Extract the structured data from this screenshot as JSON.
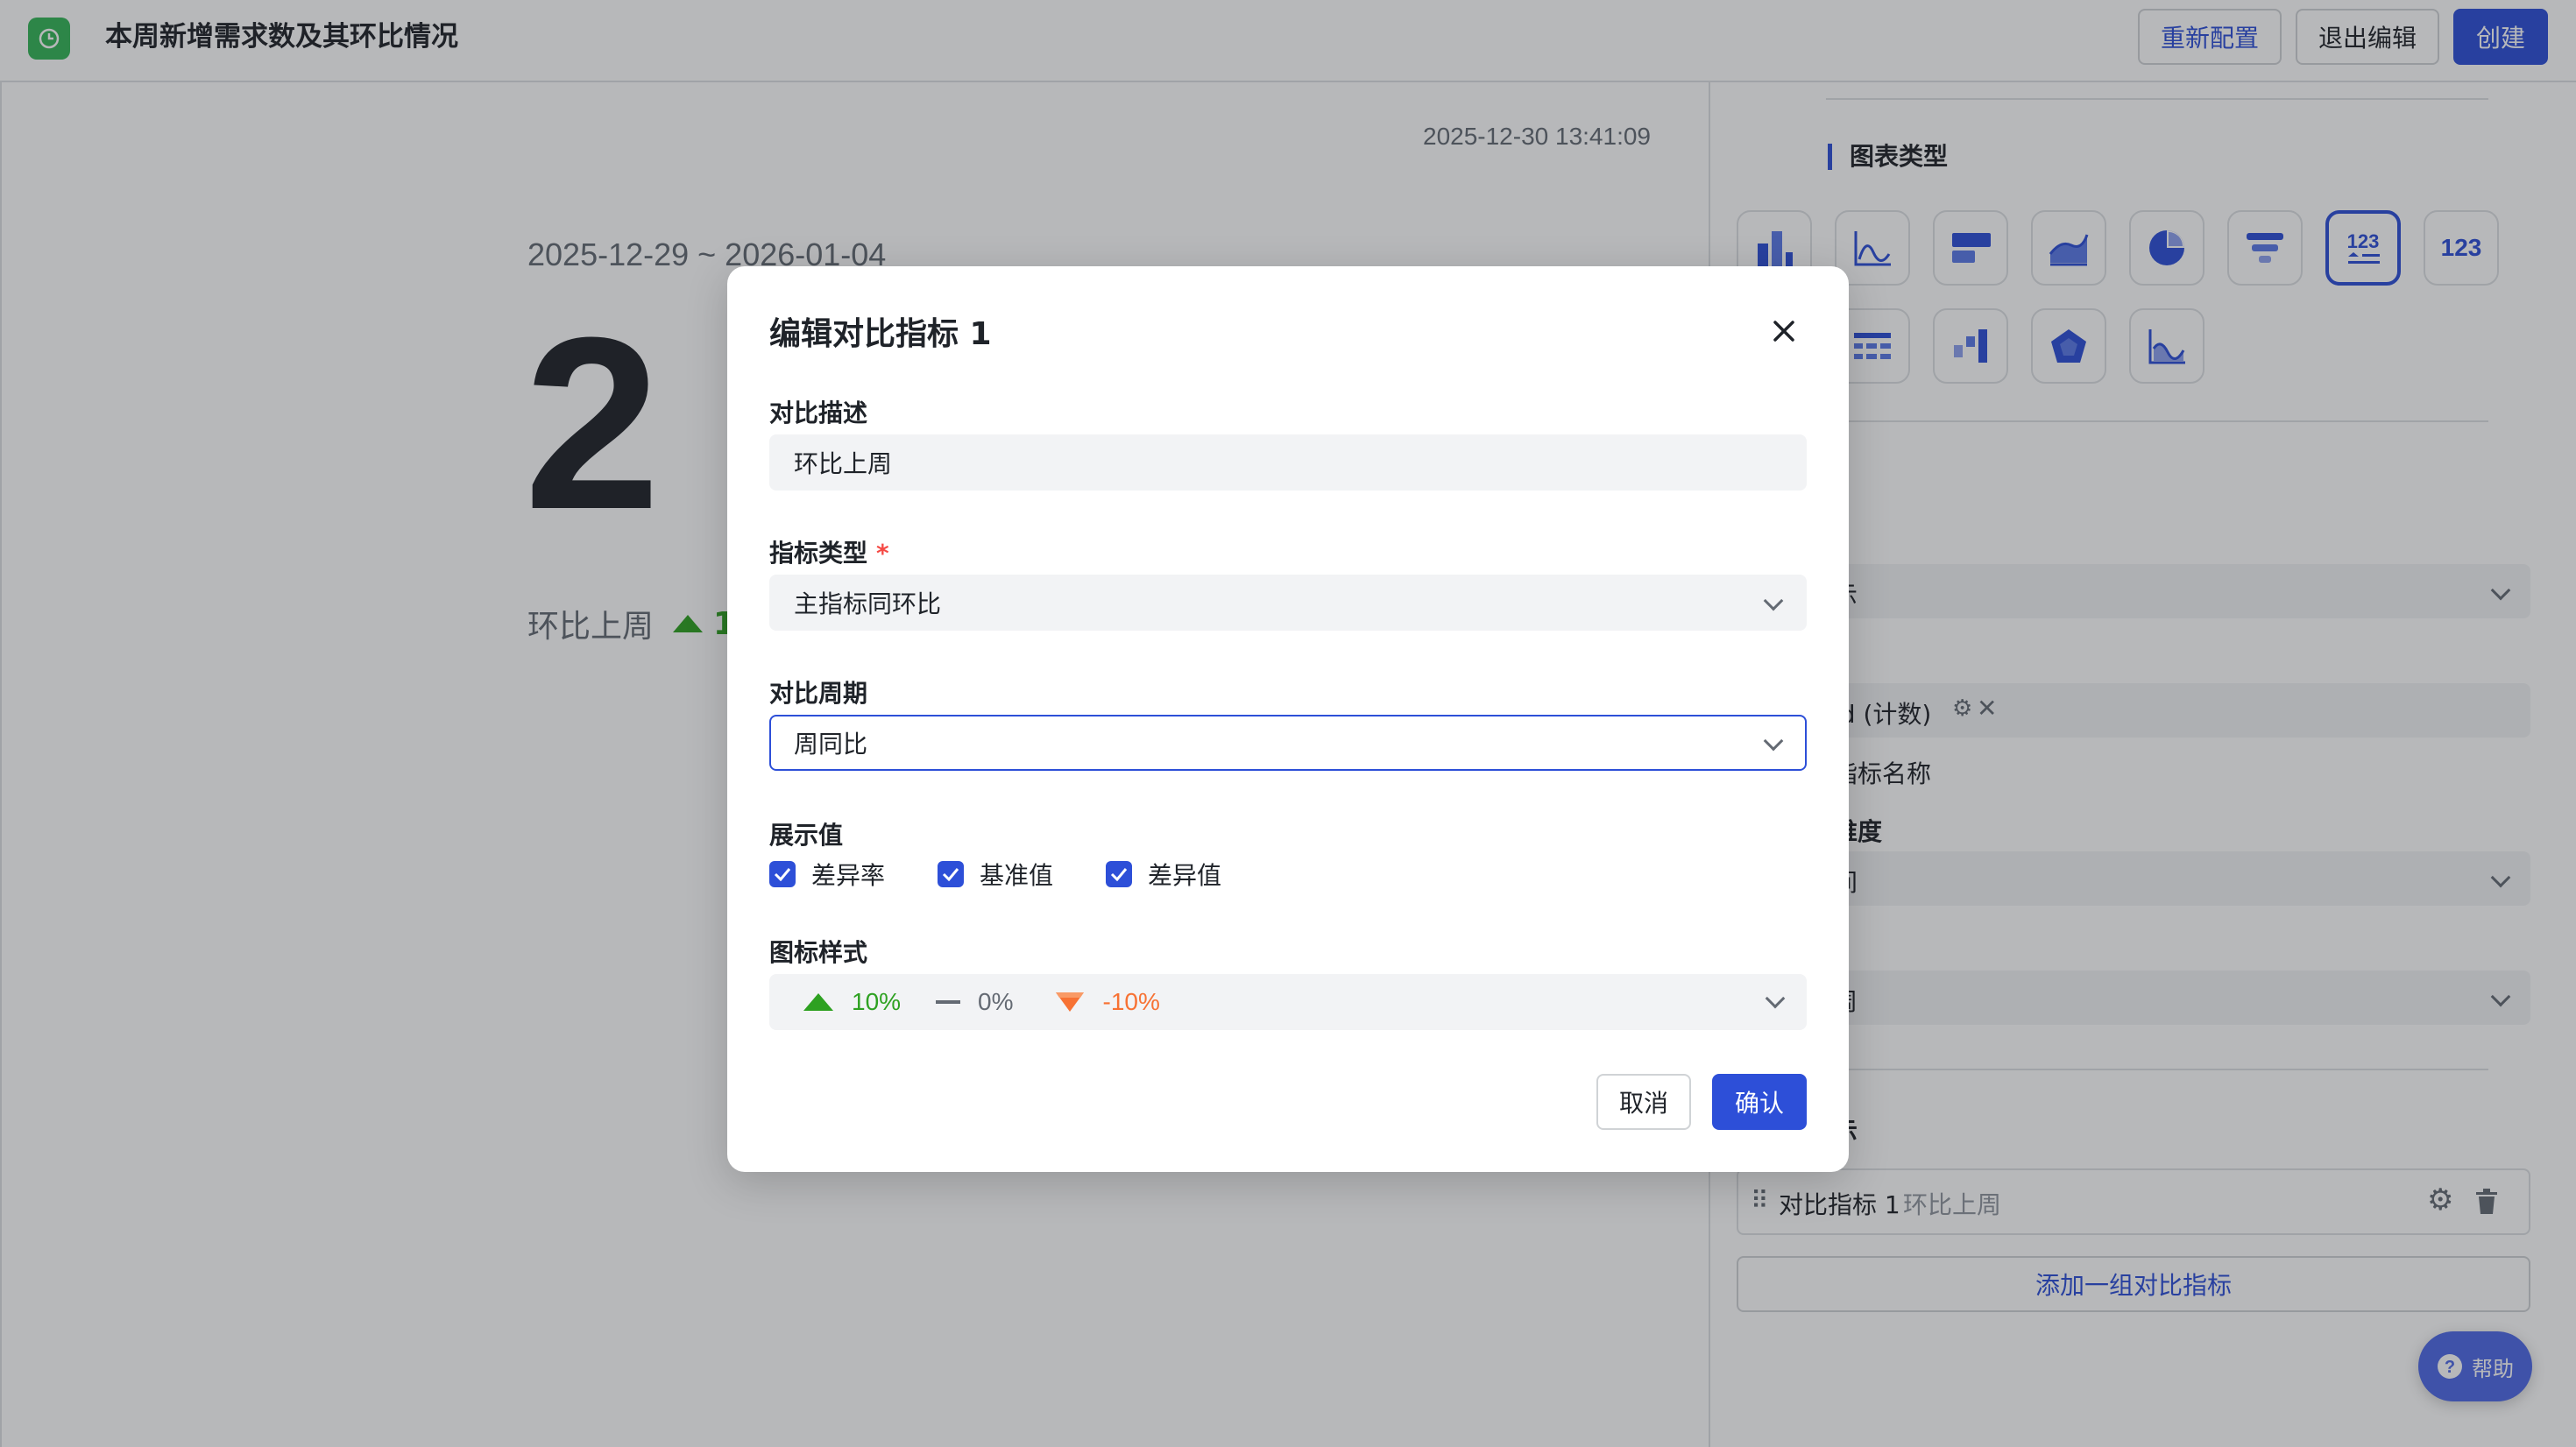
{
  "header": {
    "title": "本周新增需求数及其环比情况",
    "reconfigure_label": "重新配置",
    "exit_edit_label": "退出编辑",
    "create_label": "创建"
  },
  "canvas": {
    "timestamp": "2025-12-30 13:41:09",
    "date_range": "2025-12-29 ~ 2026-01-04",
    "big_number": "2",
    "compare_label": "环比上周",
    "compare_value_partial": "1"
  },
  "panel": {
    "chart_type_title": "图表类型",
    "number_card_label": "123",
    "number_card_label_2": "123",
    "metric_select_partial": "示",
    "field_tag": "id (计数)",
    "metric_name_partial": "指标名称",
    "dimension_label_partial": "维度",
    "select2_partial": "间",
    "select3_partial": "周",
    "compare_section_partial": "示",
    "compare_metric_name": "对比指标 1",
    "compare_metric_desc": "环比上周",
    "add_compare_label": "添加一组对比指标",
    "help_label": "帮助"
  },
  "modal": {
    "title": "编辑对比指标 1",
    "desc_label": "对比描述",
    "desc_value": "环比上周",
    "type_label": "指标类型",
    "type_required": "*",
    "type_value": "主指标同环比",
    "period_label": "对比周期",
    "period_value": "周同比",
    "display_label": "展示值",
    "display_options": [
      {
        "label": "差异率",
        "checked": true
      },
      {
        "label": "基准值",
        "checked": true
      },
      {
        "label": "差异值",
        "checked": true
      }
    ],
    "icon_style_label": "图标样式",
    "icon_style": {
      "up": "10%",
      "flat": "0%",
      "down": "-10%"
    },
    "cancel_label": "取消",
    "confirm_label": "确认"
  },
  "colors": {
    "primary": "#2d4fd8",
    "up_green": "#2ea121",
    "down_orange": "#f77234",
    "app_green": "#34b558"
  }
}
